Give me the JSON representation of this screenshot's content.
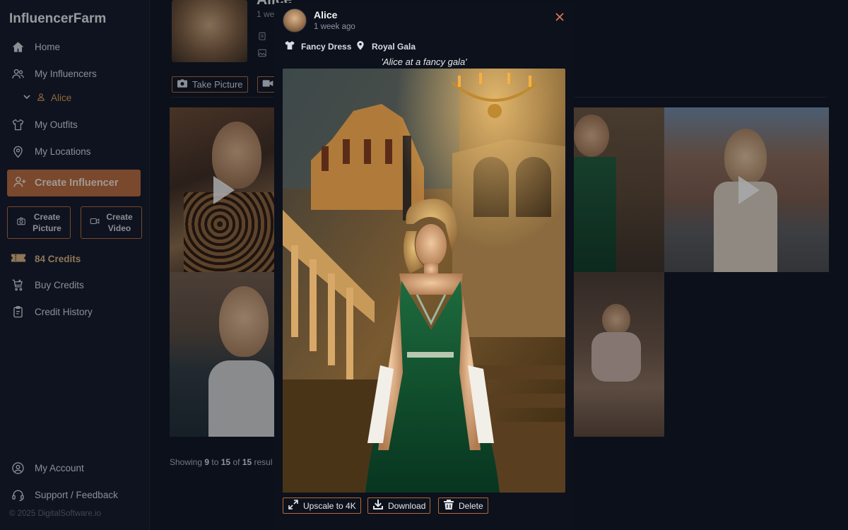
{
  "sidebar": {
    "brand": "InfluencerFarm",
    "nav": {
      "home": "Home",
      "my_influencers": "My Influencers",
      "alice": "Alice",
      "my_outfits": "My Outfits",
      "my_locations": "My Locations"
    },
    "create_influencer": "Create Influencer",
    "create_picture_l1": "Create",
    "create_picture_l2": "Picture",
    "create_video_l1": "Create",
    "create_video_l2": "Video",
    "credits": "84 Credits",
    "buy_credits": "Buy Credits",
    "credit_history": "Credit History",
    "my_account": "My Account",
    "support": "Support / Feedback",
    "copyright": "© 2025 DigitalSoftware.io"
  },
  "background": {
    "title": "Alice",
    "subtitle": "1 we",
    "take_picture": "Take Picture",
    "showing_prefix": "Showing ",
    "showing_from": "9",
    "showing_to_word": " to ",
    "showing_to": "15",
    "showing_of_word": " of ",
    "showing_total": "15",
    "showing_suffix": " resul"
  },
  "modal": {
    "name": "Alice",
    "time": "1 week ago",
    "outfit": "Fancy Dress",
    "location": "Royal Gala",
    "caption": "'Alice at a fancy gala'",
    "actions": {
      "upscale": "Upscale to 4K",
      "download": "Download",
      "delete": "Delete"
    }
  },
  "icons": [
    "home-icon",
    "users-icon",
    "user-icon",
    "chevron-down-icon",
    "shirt-icon",
    "map-pin-icon",
    "user-plus-icon",
    "camera-icon",
    "video-icon",
    "ticket-icon",
    "cart-icon",
    "clipboard-icon",
    "account-icon",
    "headset-icon",
    "close-icon",
    "expand-icon",
    "download-icon",
    "trash-icon",
    "image-icon",
    "play-icon"
  ],
  "colors": {
    "accent": "#b5693c",
    "credits": "#d6b07b",
    "active_sub": "#d69a4c",
    "background": "#0e1320",
    "sidebar": "#111827",
    "modal": "#0c111b"
  }
}
